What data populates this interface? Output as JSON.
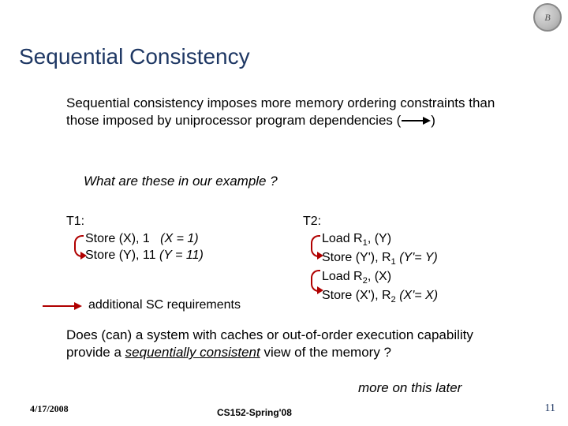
{
  "logo": "B",
  "title": "Sequential Consistency",
  "para1_a": "Sequential consistency imposes more memory ordering constraints than those imposed by uniprocessor program dependencies (",
  "para1_b": ")",
  "question": "What are these in our example ?",
  "t1": {
    "head": "T1:",
    "l1_a": "Store (X), 1",
    "l1_b": "(X = 1)",
    "l2_a": "Store (Y), 11",
    "l2_b": "(Y = 11)"
  },
  "t2": {
    "head": "T2:",
    "l1_a": "Load R",
    "l1_sub": "1",
    "l1_b": ", (Y)",
    "l2_a": "Store (Y'), R",
    "l2_sub": "1",
    "l2_b": "(Y'= Y)",
    "l3_a": "Load R",
    "l3_sub": "2",
    "l3_b": ", (X)",
    "l4_a": "Store (X'), R",
    "l4_sub": "2",
    "l4_b": "(X'= X)"
  },
  "additional": "additional SC requirements",
  "para2_a": "Does (can) a system with caches or out-of-order execution capability provide a ",
  "para2_u": "sequentially consistent",
  "para2_b": " view of the memory ?",
  "more": "more on this later",
  "footer": {
    "date": "4/17/2008",
    "course": "CS152-Spring'08",
    "page": "11"
  }
}
